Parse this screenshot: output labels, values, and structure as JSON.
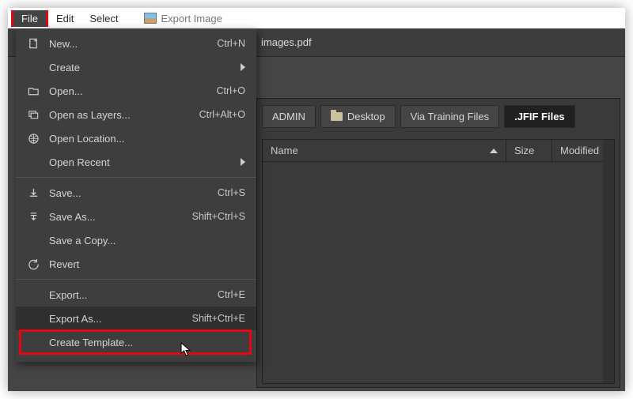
{
  "title": "Export Image",
  "menubar": {
    "file": "File",
    "edit": "Edit",
    "select": "Select"
  },
  "doc_tab": "images.pdf",
  "breadcrumb": {
    "admin": "ADMIN",
    "desktop": "Desktop",
    "training": "Via Training Files",
    "jfif": ".JFIF Files"
  },
  "columns": {
    "name": "Name",
    "size": "Size",
    "modified": "Modified"
  },
  "menu": {
    "new": "New...",
    "new_k": "Ctrl+N",
    "create": "Create",
    "open": "Open...",
    "open_k": "Ctrl+O",
    "open_layers": "Open as Layers...",
    "open_layers_k": "Ctrl+Alt+O",
    "open_loc": "Open Location...",
    "open_recent": "Open Recent",
    "save": "Save...",
    "save_k": "Ctrl+S",
    "save_as": "Save As...",
    "save_as_k": "Shift+Ctrl+S",
    "save_copy": "Save a Copy...",
    "revert": "Revert",
    "export": "Export...",
    "export_k": "Ctrl+E",
    "export_as": "Export As...",
    "export_as_k": "Shift+Ctrl+E",
    "create_tmpl": "Create Template..."
  }
}
